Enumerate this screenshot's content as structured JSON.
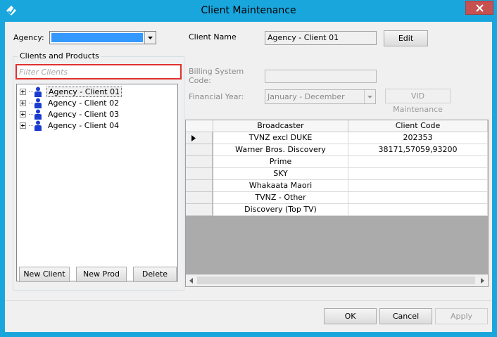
{
  "window": {
    "title": "Client Maintenance",
    "accent": "#19a6dd",
    "close_color": "#c75050"
  },
  "agency": {
    "label": "Agency:",
    "selected_value": "",
    "highlight_color": "#3399ff"
  },
  "clients_products": {
    "group_title": "Clients and Products",
    "filter_placeholder": "Filter Clients",
    "filter_border_color": "#e03030",
    "tree_items": [
      {
        "label": "Agency - Client 01",
        "selected": true
      },
      {
        "label": "Agency - Client 02",
        "selected": false
      },
      {
        "label": "Agency - Client 03",
        "selected": false
      },
      {
        "label": "Agency - Client 04",
        "selected": false
      }
    ],
    "buttons": {
      "new_client": "New Client",
      "new_prod": "New Prod",
      "delete": "Delete"
    }
  },
  "details": {
    "client_name_label": "Client Name",
    "client_name_value": "Agency - Client 01",
    "edit_label": "Edit",
    "billing_label_line1": "Billing System",
    "billing_label_line2": "Code:",
    "billing_value": "",
    "financial_year_label": "Financial Year:",
    "financial_year_value": "January - December",
    "vid_maintenance_label": "VID Maintenance"
  },
  "broadcaster_grid": {
    "columns": [
      "Broadcaster",
      "Client Code"
    ],
    "rows": [
      {
        "broadcaster": "TVNZ excl DUKE",
        "client_code": "202353",
        "current": true
      },
      {
        "broadcaster": "Warner Bros. Discovery",
        "client_code": "38171,57059,93200",
        "current": false
      },
      {
        "broadcaster": "Prime",
        "client_code": "",
        "current": false
      },
      {
        "broadcaster": "SKY",
        "client_code": "",
        "current": false
      },
      {
        "broadcaster": "Whakaata Maori",
        "client_code": "",
        "current": false
      },
      {
        "broadcaster": "TVNZ - Other",
        "client_code": "",
        "current": false
      },
      {
        "broadcaster": "Discovery (Top TV)",
        "client_code": "",
        "current": false
      }
    ]
  },
  "footer": {
    "ok": "OK",
    "cancel": "Cancel",
    "apply": "Apply"
  },
  "icons": {
    "app": "app-logo-icon",
    "close": "close-icon",
    "dropdown": "chevron-down-icon",
    "client_node": "person-icon",
    "expand": "plus-expander-icon",
    "current_row": "row-pointer-icon",
    "scroll_left": "scroll-left-icon",
    "scroll_right": "scroll-right-icon"
  }
}
